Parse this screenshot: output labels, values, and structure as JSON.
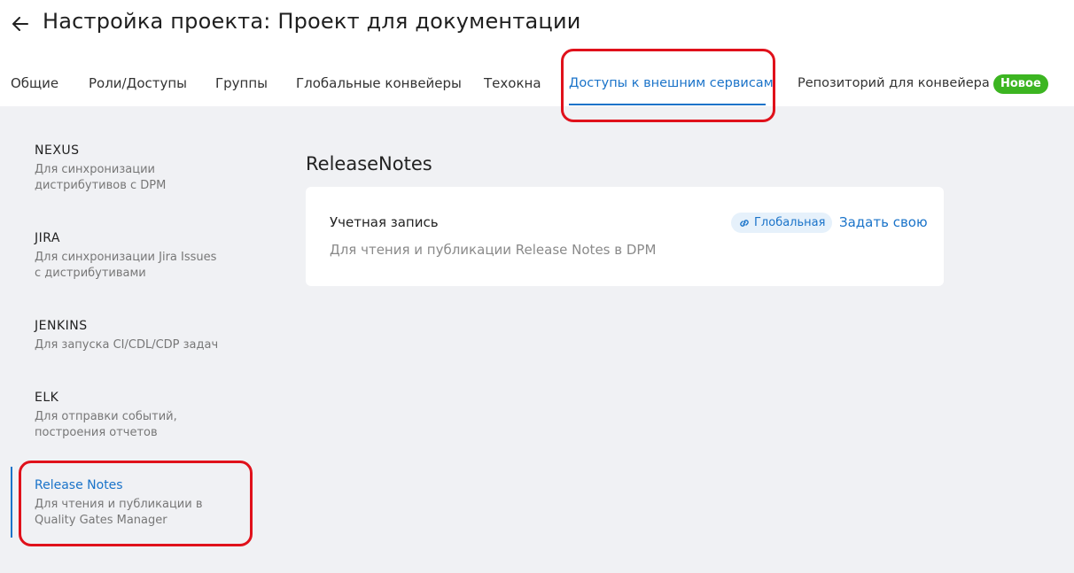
{
  "header": {
    "title": "Настройка проекта: Проект для документации"
  },
  "tabs": [
    {
      "label": "Общие"
    },
    {
      "label": "Роли/Доступы"
    },
    {
      "label": "Группы"
    },
    {
      "label": "Глобальные конвейеры"
    },
    {
      "label": "Техокна"
    },
    {
      "label": "Доступы к внешним сервисам",
      "active": true
    },
    {
      "label": "Репозиторий для конвейера",
      "badge": "Новое"
    }
  ],
  "sidebar": {
    "items": [
      {
        "title": "NEXUS",
        "desc": "Для синхронизации дистрибутивов с DPM"
      },
      {
        "title": "JIRA",
        "desc": "Для синхронизации Jira Issues с дистрибутивами"
      },
      {
        "title": "JENKINS",
        "desc": "Для запуска CI/CDL/CDP задач"
      },
      {
        "title": "ELK",
        "desc": "Для отправки событий, построения отчетов"
      },
      {
        "title": "Release Notes",
        "desc": "Для чтения и публикации в Quality Gates Manager",
        "active": true
      }
    ]
  },
  "main": {
    "title": "ReleaseNotes",
    "card": {
      "label": "Учетная запись",
      "description": "Для чтения и публикации Release Notes в DPM",
      "badge": "Глобальная",
      "action": "Задать свою"
    }
  },
  "colors": {
    "accent": "#1a73c9",
    "badge_new": "#3cb521",
    "annotation": "#e0111b",
    "background": "#f0f1f4"
  }
}
